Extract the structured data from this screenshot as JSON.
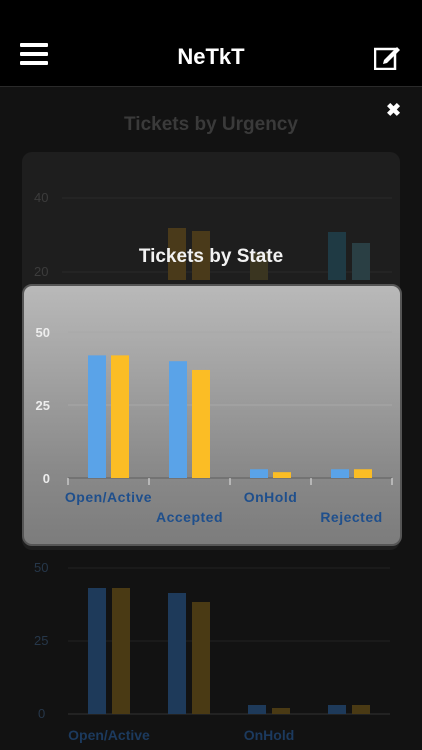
{
  "header": {
    "title": "NeTkT",
    "menu_icon": "hamburger-menu-icon",
    "edit_icon": "compose-icon"
  },
  "dialog": {
    "close_glyph": "✖",
    "title": "Tickets by State"
  },
  "background": {
    "title": "Tickets by Urgency"
  },
  "colors": {
    "series_blue": "#5aa3e8",
    "series_yellow": "#fbbd25",
    "label_blue": "#1f4f8c"
  },
  "chart_data": [
    {
      "type": "bar",
      "title": "Tickets by State",
      "categories": [
        "Open/Active",
        "Accepted",
        "OnHold",
        "Rejected"
      ],
      "series": [
        {
          "values": [
            42,
            40,
            3,
            3
          ]
        },
        {
          "values": [
            42,
            37,
            2,
            3
          ]
        }
      ],
      "ylim": [
        0,
        50
      ],
      "yticks": [
        0,
        25,
        50
      ],
      "grid": true
    },
    {
      "type": "bar",
      "title": "Tickets by Urgency",
      "series": [
        {
          "values": [
            null,
            33,
            null,
            32
          ]
        },
        {
          "values": [
            null,
            32,
            null,
            29
          ]
        }
      ],
      "ylim": [
        0,
        40
      ],
      "yticks": [
        20,
        40
      ]
    }
  ]
}
